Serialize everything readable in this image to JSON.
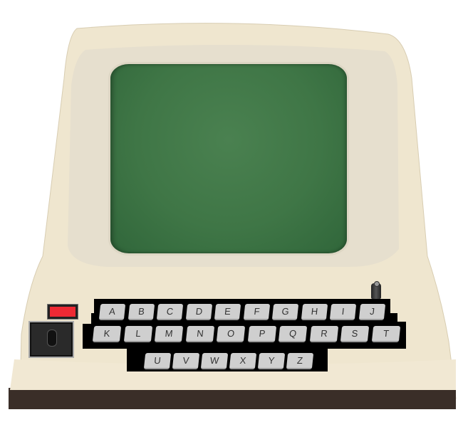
{
  "keyboard": {
    "rows": [
      [
        "A",
        "B",
        "C",
        "D",
        "E",
        "F",
        "G",
        "H",
        "I",
        "J"
      ],
      [
        "K",
        "L",
        "M",
        "N",
        "O",
        "P",
        "Q",
        "R",
        "S",
        "T"
      ],
      [
        "U",
        "V",
        "W",
        "X",
        "Y",
        "Z"
      ]
    ]
  },
  "colors": {
    "screen": "#3f7646",
    "housing": "#efe6cf",
    "key": "#cfcfcf",
    "power_led": "#ee2a34"
  }
}
